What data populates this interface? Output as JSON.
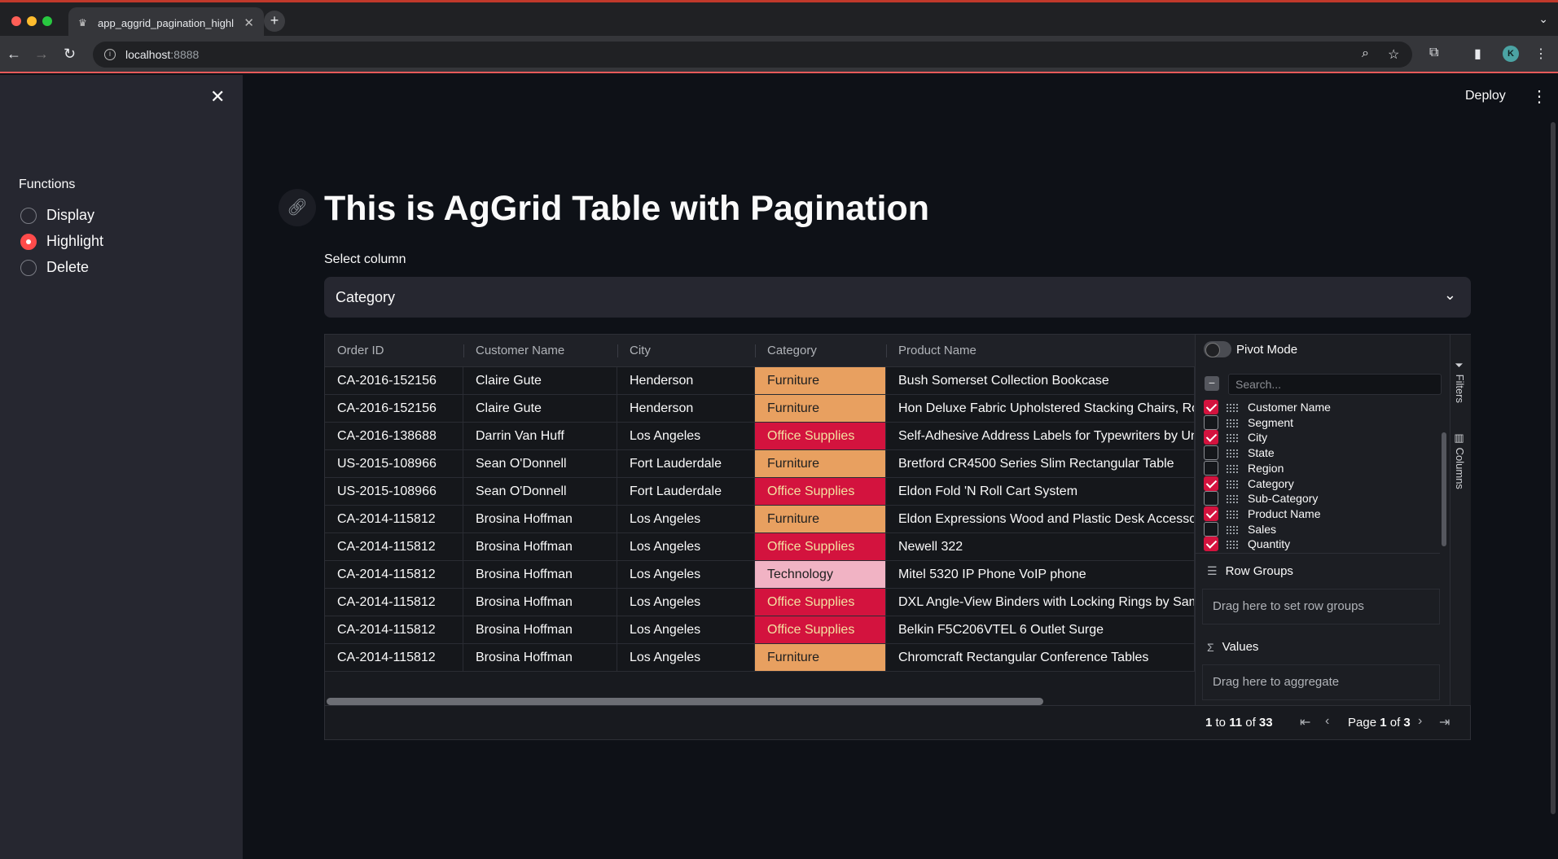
{
  "browser": {
    "tab_title": "app_aggrid_pagination_highl",
    "url_host": "localhost",
    "url_port": ":8888"
  },
  "app": {
    "deploy_label": "Deploy",
    "title": "This is AgGrid Table with Pagination",
    "select_label": "Select column",
    "select_value": "Category"
  },
  "sidebar": {
    "label": "Functions",
    "options": [
      "Display",
      "Highlight",
      "Delete"
    ],
    "selected": "Highlight"
  },
  "grid": {
    "columns": [
      "Order ID",
      "Customer Name",
      "City",
      "Category",
      "Product Name"
    ],
    "rows": [
      [
        "CA-2016-152156",
        "Claire Gute",
        "Henderson",
        "Furniture",
        "Bush Somerset Collection Bookcase"
      ],
      [
        "CA-2016-152156",
        "Claire Gute",
        "Henderson",
        "Furniture",
        "Hon Deluxe Fabric Upholstered Stacking Chairs, Rou"
      ],
      [
        "CA-2016-138688",
        "Darrin Van Huff",
        "Los Angeles",
        "Office Supplies",
        "Self-Adhesive Address Labels for Typewriters by Uni"
      ],
      [
        "US-2015-108966",
        "Sean O'Donnell",
        "Fort Lauderdale",
        "Furniture",
        "Bretford CR4500 Series Slim Rectangular Table"
      ],
      [
        "US-2015-108966",
        "Sean O'Donnell",
        "Fort Lauderdale",
        "Office Supplies",
        "Eldon Fold 'N Roll Cart System"
      ],
      [
        "CA-2014-115812",
        "Brosina Hoffman",
        "Los Angeles",
        "Furniture",
        "Eldon Expressions Wood and Plastic Desk Accessori"
      ],
      [
        "CA-2014-115812",
        "Brosina Hoffman",
        "Los Angeles",
        "Office Supplies",
        "Newell 322"
      ],
      [
        "CA-2014-115812",
        "Brosina Hoffman",
        "Los Angeles",
        "Technology",
        "Mitel 5320 IP Phone VoIP phone"
      ],
      [
        "CA-2014-115812",
        "Brosina Hoffman",
        "Los Angeles",
        "Office Supplies",
        "DXL Angle-View Binders with Locking Rings by Sams"
      ],
      [
        "CA-2014-115812",
        "Brosina Hoffman",
        "Los Angeles",
        "Office Supplies",
        "Belkin F5C206VTEL 6 Outlet Surge"
      ],
      [
        "CA-2014-115812",
        "Brosina Hoffman",
        "Los Angeles",
        "Furniture",
        "Chromcraft Rectangular Conference Tables"
      ]
    ],
    "category_colors": {
      "Furniture": "#e8a060",
      "Office Supplies": "#d3133e",
      "Technology": "#f1b3c4"
    }
  },
  "tool_panel": {
    "pivot_label": "Pivot Mode",
    "search_placeholder": "Search...",
    "columns": [
      {
        "name": "Customer Name",
        "checked": true
      },
      {
        "name": "Segment",
        "checked": false
      },
      {
        "name": "City",
        "checked": true
      },
      {
        "name": "State",
        "checked": false
      },
      {
        "name": "Region",
        "checked": false
      },
      {
        "name": "Category",
        "checked": true
      },
      {
        "name": "Sub-Category",
        "checked": false
      },
      {
        "name": "Product Name",
        "checked": true
      },
      {
        "name": "Sales",
        "checked": false
      },
      {
        "name": "Quantity",
        "checked": true
      }
    ],
    "row_groups_title": "Row Groups",
    "row_groups_hint": "Drag here to set row groups",
    "values_title": "Values",
    "values_hint": "Drag here to aggregate",
    "tab_filters": "Filters",
    "tab_columns": "Columns"
  },
  "pagination": {
    "from": "1",
    "to": "11",
    "total": "33",
    "page": "1",
    "page_count": "3",
    "word_to": "to",
    "word_of": "of",
    "word_page": "Page"
  },
  "colors": {
    "accent": "#ff4b4b",
    "checkbox": "#d3133e"
  }
}
